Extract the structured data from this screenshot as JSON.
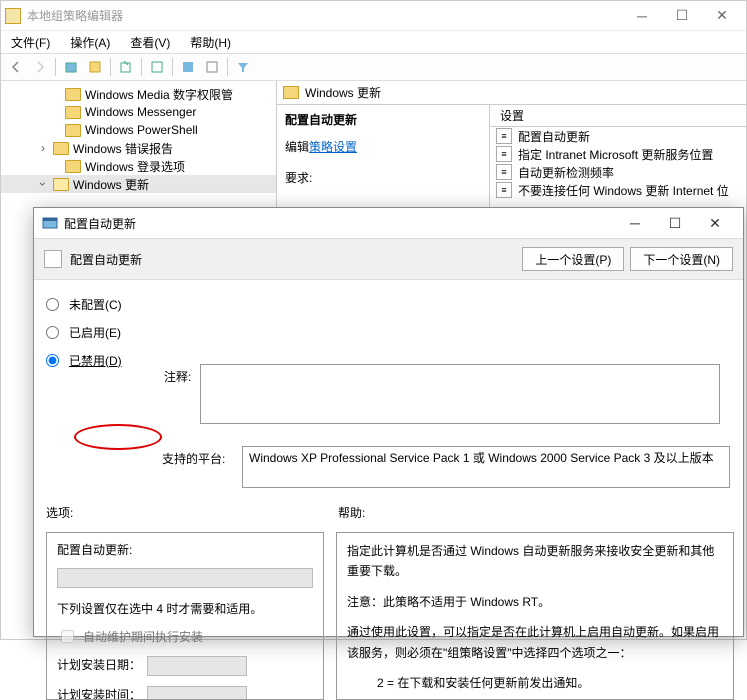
{
  "main": {
    "title": "本地组策略编辑器",
    "menu": {
      "file": "文件(F)",
      "action": "操作(A)",
      "view": "查看(V)",
      "help": "帮助(H)"
    },
    "tree": [
      {
        "label": "Windows Media 数字权限管"
      },
      {
        "label": "Windows Messenger"
      },
      {
        "label": "Windows PowerShell"
      },
      {
        "label": "Windows 错误报告"
      },
      {
        "label": "Windows 登录选项"
      },
      {
        "label": "Windows 更新",
        "selected": true
      }
    ],
    "right": {
      "header": "Windows 更新",
      "left": {
        "heading": "配置自动更新",
        "edit_prefix": "编辑",
        "edit_link": "策略设置",
        "req_label": "要求:"
      },
      "col_header": "设置",
      "rows": [
        "配置自动更新",
        "指定 Intranet Microsoft 更新服务位置",
        "自动更新检测频率",
        "不要连接任何 Windows 更新 Internet 位"
      ]
    }
  },
  "dialog": {
    "title": "配置自动更新",
    "toolbar_label": "配置自动更新",
    "prev_btn": "上一个设置(P)",
    "next_btn": "下一个设置(N)",
    "radios": {
      "not_configured": "未配置(C)",
      "enabled": "已启用(E)",
      "disabled": "已禁用(D)"
    },
    "comment_label": "注释:",
    "platform_label": "支持的平台:",
    "platform_text": "Windows XP Professional Service Pack 1 或 Windows 2000 Service Pack 3 及以上版本",
    "options_label": "选项:",
    "help_label": "帮助:",
    "options": {
      "heading": "配置自动更新:",
      "note": "下列设置仅在选中 4 时才需要和适用。",
      "chk": "自动维护期间执行安装",
      "date_label": "计划安装日期：",
      "time_label": "计划安装时间："
    },
    "help_text": {
      "p1": "指定此计算机是否通过 Windows 自动更新服务来接收安全更新和其他重要下载。",
      "p2": "注意：此策略不适用于 Windows RT。",
      "p3": "通过使用此设置，可以指定是否在此计算机上启用自动更新。如果启用该服务，则必须在\"组策略设置\"中选择四个选项之一：",
      "p4": "2 = 在下载和安装任何更新前发出通知。"
    }
  }
}
